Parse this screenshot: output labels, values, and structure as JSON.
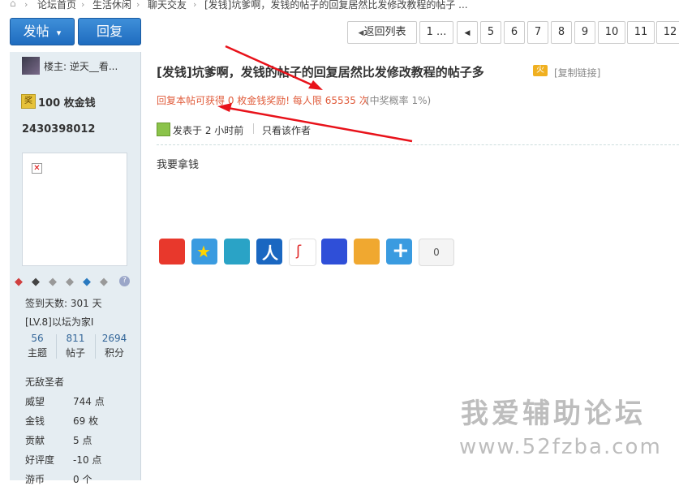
{
  "breadcrumb": {
    "items": [
      "论坛首页",
      "生活休闲",
      "聊天交友",
      "[发钱]坑爹啊，发钱的帖子的回复居然比发修改教程的帖子 ..."
    ]
  },
  "toolbar": {
    "post_label": "发帖",
    "post_dropdown": "▾",
    "reply_label": "回复",
    "back_label": "返回列表",
    "page_ellipsis": "1 ...",
    "pages": [
      "5",
      "6",
      "7",
      "8",
      "9",
      "10",
      "11",
      "12"
    ]
  },
  "author": {
    "name": "楼主: 逆天__看...",
    "coins": "100 枚金钱",
    "coins_badge": "奖",
    "uid": "2430398012",
    "signin": "签到天数: 301 天",
    "level": "[LV.8]以坛为家I",
    "stats": [
      {
        "value": "56",
        "label": "主题"
      },
      {
        "value": "811",
        "label": "帖子"
      },
      {
        "value": "2694",
        "label": "积分"
      }
    ],
    "title": "无敌圣者",
    "attrs": [
      {
        "label": "威望",
        "value": "744 点"
      },
      {
        "label": "金钱",
        "value": "69 枚"
      },
      {
        "label": "贡献",
        "value": "5 点"
      },
      {
        "label": "好评度",
        "value": "-10 点"
      },
      {
        "label": "游币",
        "value": "0 个"
      }
    ]
  },
  "post": {
    "title": "[发钱]坑爹啊，发钱的帖子的回复居然比发修改教程的帖子多",
    "hot_badge": "火",
    "copy_link": "[复制链接]",
    "reward_text": "回复本帖可获得 0 枚金钱奖励! 每人限 65535 次",
    "reward_chance": "(中奖概率 1%)",
    "posted_time": "发表于 2 小时前",
    "only_author": "只看该作者",
    "content": "我要拿钱",
    "share_count": "0"
  },
  "watermark": {
    "line1": "我爱辅助论坛",
    "line2": "www.52fzba.com"
  },
  "colors": {
    "accent_blue": "#1f6cbf",
    "reward_red": "#e05b3a",
    "sidebar_bg": "#e5edf2",
    "arrow_red": "#e8121a"
  }
}
